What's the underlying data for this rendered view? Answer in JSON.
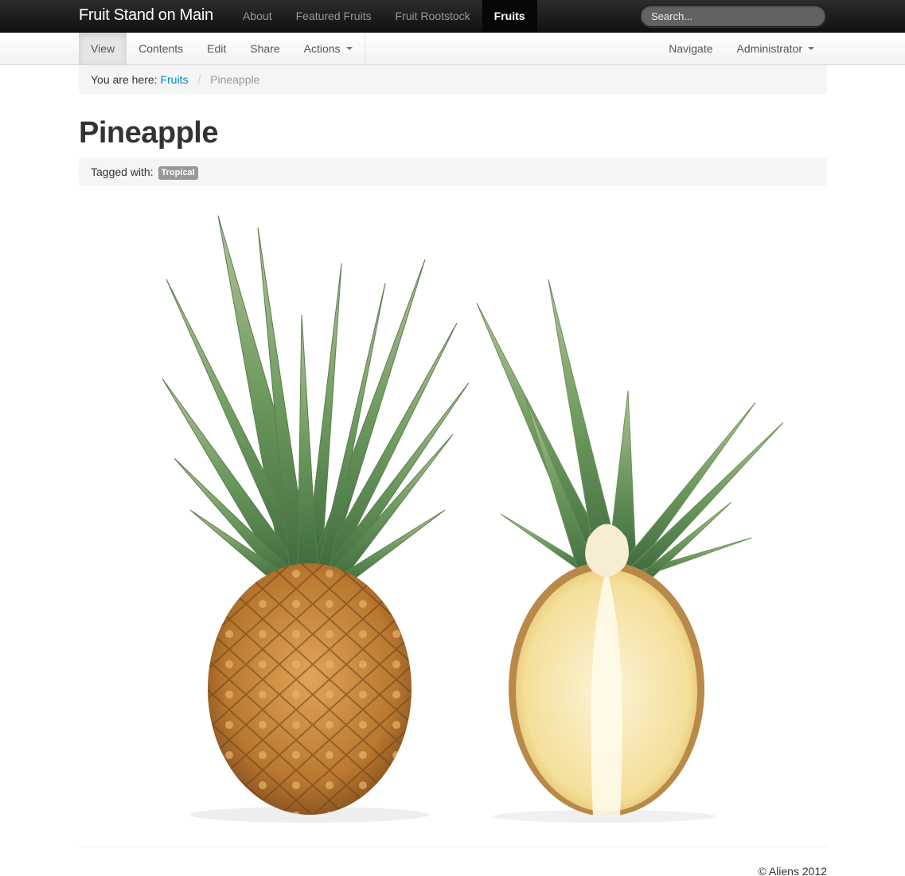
{
  "topbar": {
    "brand": "Fruit Stand on Main",
    "nav": [
      "About",
      "Featured Fruits",
      "Fruit Rootstock",
      "Fruits"
    ],
    "active_nav": "Fruits",
    "search_placeholder": "Search..."
  },
  "toolbar": {
    "left": [
      "View",
      "Contents",
      "Edit",
      "Share",
      "Actions"
    ],
    "active": "View",
    "right": [
      "Navigate",
      "Administrator"
    ]
  },
  "breadcrumb": {
    "prefix": "You are here:",
    "link": "Fruits",
    "separator": "/",
    "current": "Pineapple"
  },
  "page": {
    "title": "Pineapple",
    "tagged_label": "Tagged with:",
    "tag": "Tropical",
    "image_icon": "pineapple-photo"
  },
  "footer": {
    "copyright": "© Aliens 2012"
  },
  "colors": {
    "link": "#0088cc",
    "topbar": "#1b1b1b",
    "tag": "#999999"
  }
}
